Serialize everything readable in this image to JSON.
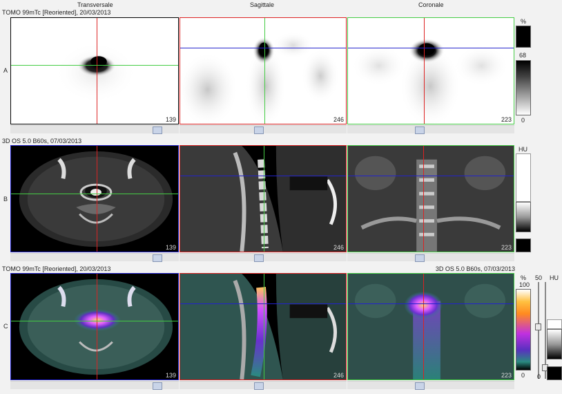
{
  "headers": {
    "transversal": "Transversale",
    "sagittal": "Sagittale",
    "coronal": "Coronale"
  },
  "rows": {
    "a": {
      "label": "A",
      "series": "TOMO 99mTc [Reoriented], 20/03/2013",
      "slices": [
        "139",
        "246",
        "223"
      ]
    },
    "b": {
      "label": "B",
      "series": "3D  OS  5.0  B60s, 07/03/2013",
      "slices": [
        "139",
        "246",
        "223"
      ]
    },
    "c": {
      "label": "C",
      "series_left": "TOMO 99mTc [Reoriented], 20/03/2013",
      "series_right": "3D  OS  5.0  B60s, 07/03/2013",
      "slices": [
        "139",
        "246",
        "223"
      ]
    }
  },
  "scales": {
    "a": {
      "unit": "%",
      "max": "68",
      "min": "0"
    },
    "b": {
      "unit": "HU"
    },
    "c": {
      "unit": "%",
      "max": "100",
      "min": "0",
      "opacity": "50",
      "ct_unit": "HU",
      "ct_min": "0"
    }
  },
  "colors": {
    "crosshair_red": "#dd2222",
    "crosshair_green": "#44cc44",
    "crosshair_blue": "#2222cc"
  }
}
